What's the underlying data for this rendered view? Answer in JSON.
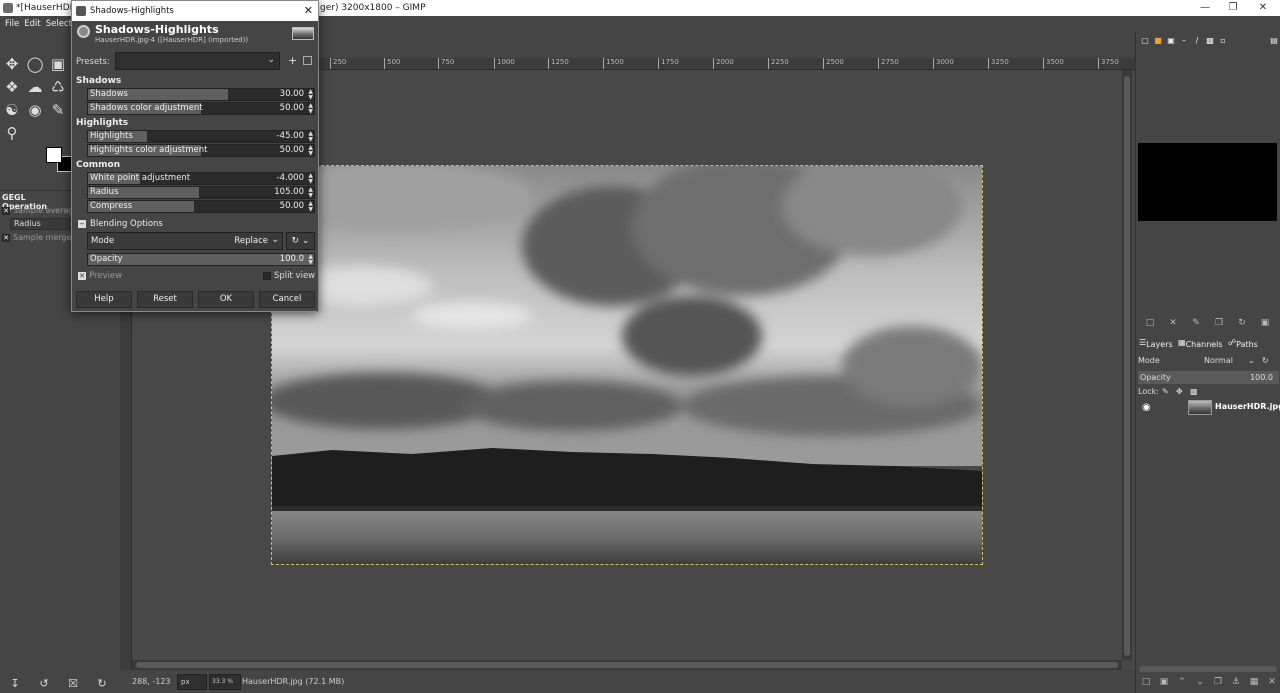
{
  "window": {
    "title_left": "*[HauserHDR] (",
    "title_right": "ger) 3200x1800 – GIMP"
  },
  "menubar": [
    "File",
    "Edit",
    "Select"
  ],
  "tool_options": {
    "title": "GEGL Operation",
    "sample_average": "Sample average",
    "radius_label": "Radius",
    "sample_merged": "Sample merged"
  },
  "ruler": {
    "ticks": [
      "250",
      "500",
      "750",
      "1000",
      "1250",
      "1500",
      "1750",
      "2000",
      "2250",
      "2500",
      "2750",
      "3000",
      "3250",
      "3500",
      "3750"
    ]
  },
  "statusbar": {
    "coords": "288, -123",
    "unit": "px",
    "zoom": "33.3 %",
    "message": "HauserHDR.jpg (72.1 MB)"
  },
  "right_dock": {
    "layers_tab": "Layers",
    "channels_tab": "Channels",
    "paths_tab": "Paths",
    "mode_label": "Mode",
    "mode_value": "Normal",
    "opacity_label": "Opacity",
    "opacity_value": "100.0",
    "lock_label": "Lock:",
    "layer_name": "HauserHDR.jpg"
  },
  "dialog": {
    "title": "Shadows-Highlights",
    "heading": "Shadows-Highlights",
    "subheading": "HauserHDR.jpg-4 ([HauserHDR] (imported))",
    "presets_label": "Presets:",
    "sections": {
      "shadows": "Shadows",
      "highlights": "Highlights",
      "common": "Common"
    },
    "sliders": [
      {
        "label": "Shadows",
        "value": "30.00",
        "fraction": 0.62
      },
      {
        "label": "Shadows color adjustment",
        "value": "50.00",
        "fraction": 0.5
      },
      {
        "label": "Highlights",
        "value": "-45.00",
        "fraction": 0.26
      },
      {
        "label": "Highlights color adjustment",
        "value": "50.00",
        "fraction": 0.5
      },
      {
        "label": "White point adjustment",
        "value": "-4.000",
        "fraction": 0.23
      },
      {
        "label": "Radius",
        "value": "105.00",
        "fraction": 0.49
      },
      {
        "label": "Compress",
        "value": "50.00",
        "fraction": 0.47
      }
    ],
    "blending_options": "Blending Options",
    "mode_label": "Mode",
    "mode_value": "Replace",
    "opacity_label": "Opacity",
    "opacity_value": "100.0",
    "preview_label": "Preview",
    "split_view_label": "Split view",
    "buttons": {
      "help": "Help",
      "reset": "Reset",
      "ok": "OK",
      "cancel": "Cancel"
    }
  }
}
